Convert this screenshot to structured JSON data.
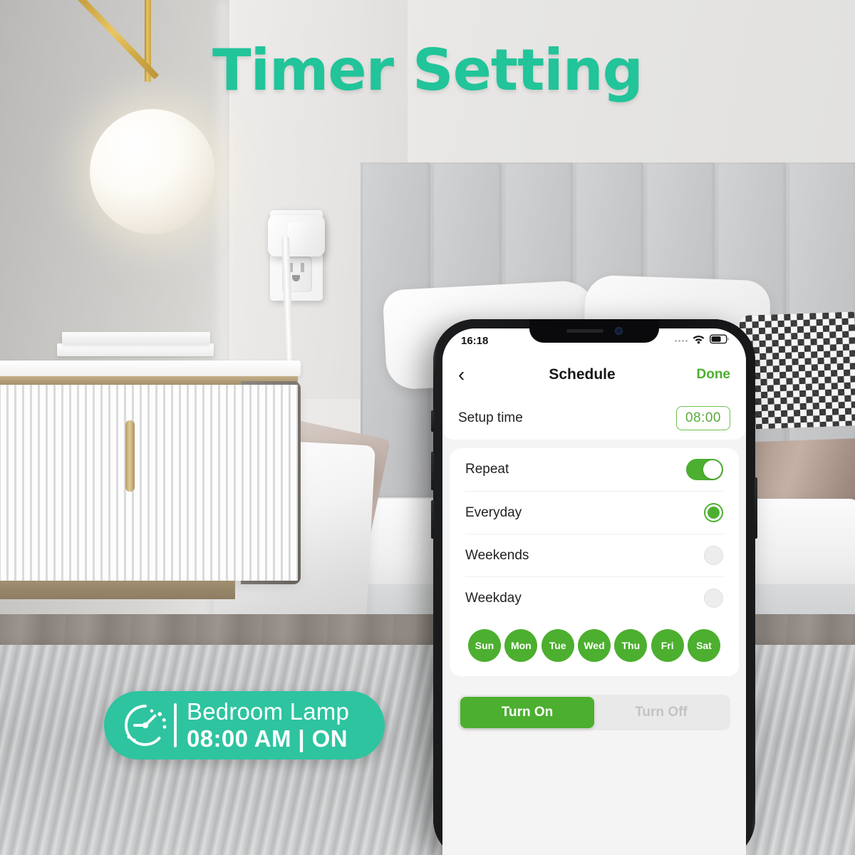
{
  "headline": "Timer Setting",
  "badge": {
    "icon": "clock-timer-icon",
    "device_name": "Bedroom Lamp",
    "status_line": "08:00 AM | ON"
  },
  "phone": {
    "status_bar": {
      "time": "16:18",
      "wifi_icon": "wifi-icon",
      "battery_icon": "battery-icon"
    },
    "nav": {
      "back_icon": "chevron-left-icon",
      "title": "Schedule",
      "done_label": "Done"
    },
    "setup_time": {
      "label": "Setup time",
      "value": "08:00"
    },
    "repeat": {
      "label": "Repeat",
      "enabled": true
    },
    "repeat_options": [
      {
        "label": "Everyday",
        "selected": true
      },
      {
        "label": "Weekends",
        "selected": false
      },
      {
        "label": "Weekday",
        "selected": false
      }
    ],
    "days": [
      {
        "label": "Sun",
        "selected": true
      },
      {
        "label": "Mon",
        "selected": true
      },
      {
        "label": "Tue",
        "selected": true
      },
      {
        "label": "Wed",
        "selected": true
      },
      {
        "label": "Thu",
        "selected": true
      },
      {
        "label": "Fri",
        "selected": true
      },
      {
        "label": "Sat",
        "selected": true
      }
    ],
    "action_segment": {
      "on_label": "Turn On",
      "off_label": "Turn Off",
      "active": "Turn On"
    }
  },
  "colors": {
    "headline_teal": "#22c49a",
    "badge_teal": "#2ec4a0",
    "app_green": "#4caf2f",
    "chip_green": "#5aab3b"
  }
}
